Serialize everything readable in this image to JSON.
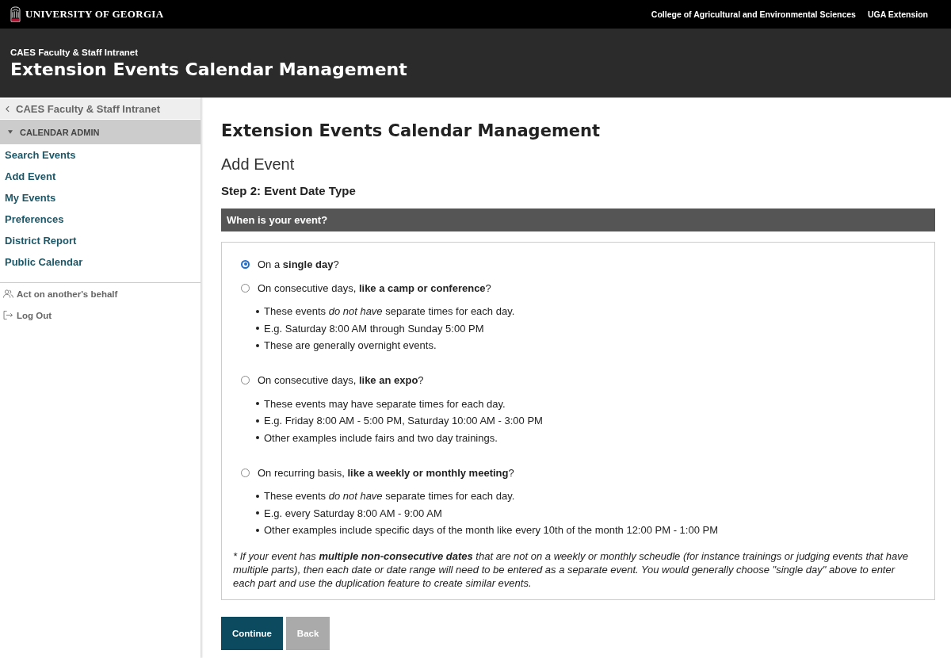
{
  "top_bar": {
    "brand": "UNIVERSITY OF GEORGIA",
    "links": [
      "College of Agricultural and Environmental Sciences",
      "UGA Extension"
    ]
  },
  "header": {
    "subtitle": "CAES Faculty & Staff Intranet",
    "title": "Extension Events Calendar Management"
  },
  "sidebar": {
    "back_link": "CAES Faculty & Staff Intranet",
    "section": {
      "label": "CALENDAR ADMIN",
      "expanded": true
    },
    "items": [
      "Search Events",
      "Add Event",
      "My Events",
      "Preferences",
      "District Report",
      "Public Calendar"
    ],
    "account_links": [
      {
        "kind": "people",
        "label": "Act on another's behalf"
      },
      {
        "kind": "logout",
        "label": "Log Out"
      }
    ]
  },
  "main": {
    "title": "Extension Events Calendar Management",
    "subtitle": "Add Event",
    "step": "Step 2: Event Date Type",
    "question": "When is your event?",
    "options": [
      {
        "label": "On a **single day**?",
        "selected": true
      },
      {
        "label": "On consecutive days, **like a camp or conference**?",
        "selected": false,
        "bullets": [
          "These events *do not have* separate times for each day.",
          "E.g. Saturday 8:00 AM through Sunday 5:00 PM",
          "These are generally overnight events."
        ]
      },
      {
        "label": "On consecutive days, **like an expo**?",
        "selected": false,
        "bullets": [
          "These events may have separate times for each day.",
          "E.g. Friday 8:00 AM - 5:00 PM, Saturday 10:00 AM - 3:00 PM",
          "Other examples include fairs and two day trainings."
        ]
      },
      {
        "label": "On recurring basis, **like a weekly or monthly meeting**?",
        "selected": false,
        "bullets": [
          "These events *do not have* separate times for each day.",
          "E.g. every Saturday 8:00 AM - 9:00 AM",
          "Other examples include specific days of the month like every 10th of the month 12:00 PM - 1:00 PM"
        ]
      }
    ],
    "footnote": "* If your event has **multiple non-consecutive dates** that are not on a weekly or monthly scheudle (for instance trainings or judging events that have multiple parts), then each date or date range will need to be entered as a separate event. You would generally choose \"single day\" above to enter each part and use the duplication feature to create similar events.",
    "buttons": [
      {
        "kind": "primary",
        "label": "Continue"
      },
      {
        "kind": "secondary",
        "label": "Back"
      }
    ]
  }
}
